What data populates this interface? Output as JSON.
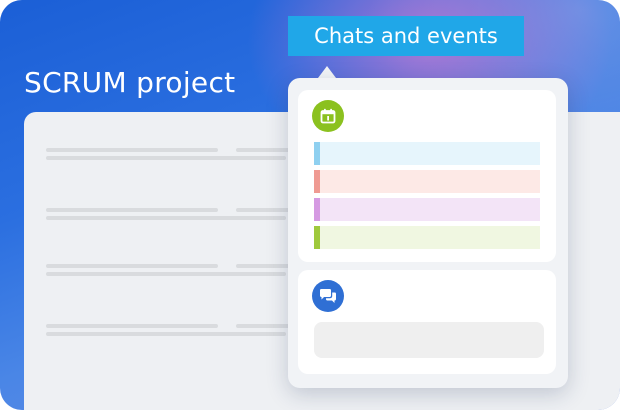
{
  "project": {
    "title": "SCRUM project"
  },
  "tag": {
    "label": "Chats and events"
  },
  "colors": {
    "accent": "#20a7e8",
    "calendar_icon_bg": "#8bc11f",
    "chat_icon_bg": "#2f6fd4"
  },
  "events": {
    "icon": "calendar-icon",
    "items": [
      {
        "bar": "#8fd0f0",
        "fill": "#e6f5fc"
      },
      {
        "bar": "#ef9a92",
        "fill": "#fde9e6"
      },
      {
        "bar": "#d59ae2",
        "fill": "#f3e4f7"
      },
      {
        "bar": "#9fc93c",
        "fill": "#f0f7e1"
      }
    ]
  },
  "chats": {
    "icon": "chat-bubbles-icon",
    "input_placeholder": ""
  }
}
